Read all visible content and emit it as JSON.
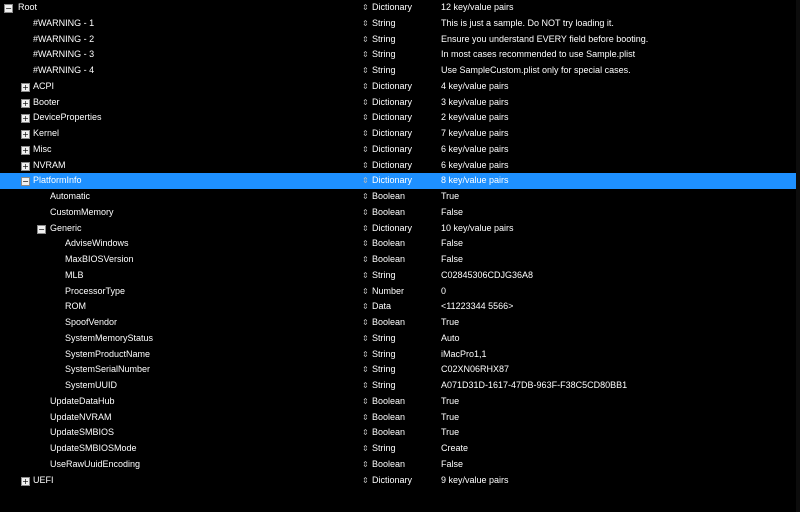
{
  "icons": {
    "expanded": "minus-box-icon",
    "collapsed": "plus-box-icon",
    "type_spinner": "up-down-arrows-icon"
  },
  "colors": {
    "background": "#000000",
    "selection": "#1e90ff",
    "text": "#ffffff"
  },
  "rows": [
    {
      "key": "Root",
      "type": "Dictionary",
      "value": "12 key/value pairs",
      "level": 0,
      "expander": "open"
    },
    {
      "key": "#WARNING - 1",
      "type": "String",
      "value": "This is just a sample. Do NOT try loading it.",
      "level": 1,
      "expander": null
    },
    {
      "key": "#WARNING - 2",
      "type": "String",
      "value": "Ensure you understand EVERY field before booting.",
      "level": 1,
      "expander": null
    },
    {
      "key": "#WARNING - 3",
      "type": "String",
      "value": "In most cases recommended to use Sample.plist",
      "level": 1,
      "expander": null
    },
    {
      "key": "#WARNING - 4",
      "type": "String",
      "value": "Use SampleCustom.plist only for special cases.",
      "level": 1,
      "expander": null
    },
    {
      "key": "ACPI",
      "type": "Dictionary",
      "value": "4 key/value pairs",
      "level": 1,
      "expander": "closed"
    },
    {
      "key": "Booter",
      "type": "Dictionary",
      "value": "3 key/value pairs",
      "level": 1,
      "expander": "closed"
    },
    {
      "key": "DeviceProperties",
      "type": "Dictionary",
      "value": "2 key/value pairs",
      "level": 1,
      "expander": "closed"
    },
    {
      "key": "Kernel",
      "type": "Dictionary",
      "value": "7 key/value pairs",
      "level": 1,
      "expander": "closed"
    },
    {
      "key": "Misc",
      "type": "Dictionary",
      "value": "6 key/value pairs",
      "level": 1,
      "expander": "closed"
    },
    {
      "key": "NVRAM",
      "type": "Dictionary",
      "value": "6 key/value pairs",
      "level": 1,
      "expander": "closed"
    },
    {
      "key": "PlatformInfo",
      "type": "Dictionary",
      "value": "8 key/value pairs",
      "level": 1,
      "expander": "open",
      "selected": true
    },
    {
      "key": "Automatic",
      "type": "Boolean",
      "value": "True",
      "level": 2,
      "expander": null
    },
    {
      "key": "CustomMemory",
      "type": "Boolean",
      "value": "False",
      "level": 2,
      "expander": null
    },
    {
      "key": "Generic",
      "type": "Dictionary",
      "value": "10 key/value pairs",
      "level": 2,
      "expander": "open"
    },
    {
      "key": "AdviseWindows",
      "type": "Boolean",
      "value": "False",
      "level": 3,
      "expander": null
    },
    {
      "key": "MaxBIOSVersion",
      "type": "Boolean",
      "value": "False",
      "level": 3,
      "expander": null
    },
    {
      "key": "MLB",
      "type": "String",
      "value": "C02845306CDJG36A8",
      "level": 3,
      "expander": null
    },
    {
      "key": "ProcessorType",
      "type": "Number",
      "value": "0",
      "level": 3,
      "expander": null
    },
    {
      "key": "ROM",
      "type": "Data",
      "value": "<11223344 5566>",
      "level": 3,
      "expander": null
    },
    {
      "key": "SpoofVendor",
      "type": "Boolean",
      "value": "True",
      "level": 3,
      "expander": null
    },
    {
      "key": "SystemMemoryStatus",
      "type": "String",
      "value": "Auto",
      "level": 3,
      "expander": null
    },
    {
      "key": "SystemProductName",
      "type": "String",
      "value": "iMacPro1,1",
      "level": 3,
      "expander": null
    },
    {
      "key": "SystemSerialNumber",
      "type": "String",
      "value": "C02XN06RHX87",
      "level": 3,
      "expander": null
    },
    {
      "key": "SystemUUID",
      "type": "String",
      "value": "A071D31D-1617-47DB-963F-F38C5CD80BB1",
      "level": 3,
      "expander": null
    },
    {
      "key": "UpdateDataHub",
      "type": "Boolean",
      "value": "True",
      "level": 2,
      "expander": null
    },
    {
      "key": "UpdateNVRAM",
      "type": "Boolean",
      "value": "True",
      "level": 2,
      "expander": null
    },
    {
      "key": "UpdateSMBIOS",
      "type": "Boolean",
      "value": "True",
      "level": 2,
      "expander": null
    },
    {
      "key": "UpdateSMBIOSMode",
      "type": "String",
      "value": "Create",
      "level": 2,
      "expander": null
    },
    {
      "key": "UseRawUuidEncoding",
      "type": "Boolean",
      "value": "False",
      "level": 2,
      "expander": null
    },
    {
      "key": "UEFI",
      "type": "Dictionary",
      "value": "9 key/value pairs",
      "level": 1,
      "expander": "closed"
    }
  ]
}
